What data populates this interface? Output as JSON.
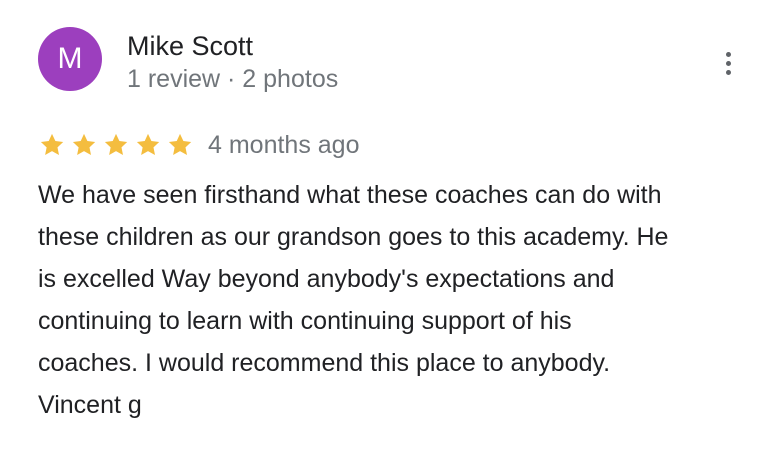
{
  "reviewer": {
    "initial": "M",
    "name": "Mike Scott",
    "meta": "1 review · 2 photos",
    "avatar_color": "#9c3fbe"
  },
  "more_icon": "more-vert-icon",
  "rating": {
    "stars": 5,
    "max_stars": 5,
    "star_color": "#f4bd3f",
    "date": "4 months ago"
  },
  "review": {
    "lines": [
      "We have seen firsthand what these coaches can do with",
      "these children as our grandson goes to this academy. He",
      "is excelled Way beyond anybody's expectations and",
      "continuing to learn with continuing support of his",
      "coaches. I would recommend this place to anybody.",
      "Vincent g"
    ]
  }
}
